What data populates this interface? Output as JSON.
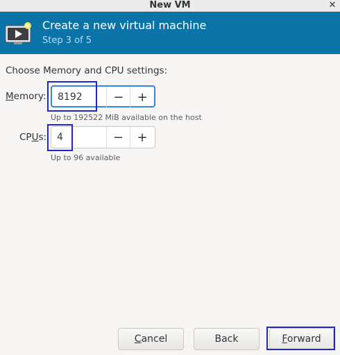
{
  "window": {
    "title": "New VM",
    "close_glyph": "✕"
  },
  "header": {
    "title": "Create a new virtual machine",
    "step": "Step 3 of 5",
    "icon": "vm-monitor-icon",
    "background_color": "#0a73a7"
  },
  "content": {
    "intro": "Choose Memory and CPU settings:",
    "memory": {
      "label_mnemonic": "M",
      "label_rest": "emory:",
      "value": "8192",
      "hint": "Up to 192522 MiB available on the host"
    },
    "cpus": {
      "label_pre": "CP",
      "label_mnemonic": "U",
      "label_post": "s:",
      "value": "4",
      "hint": "Up to 96 available"
    },
    "decrement_glyph": "−",
    "increment_glyph": "+"
  },
  "buttons": {
    "cancel": {
      "mnemonic": "C",
      "rest": "ancel"
    },
    "back": {
      "label": "Back"
    },
    "forward": {
      "mnemonic": "F",
      "rest": "orward"
    }
  },
  "highlight_color": "#2027c7"
}
